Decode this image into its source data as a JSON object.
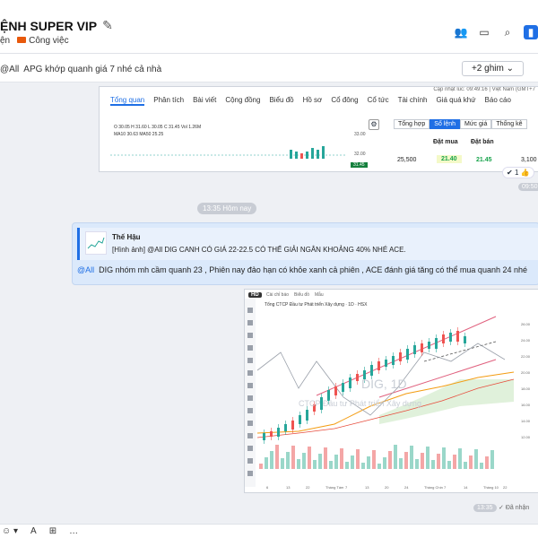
{
  "header": {
    "title": "ỆNH SUPER VIP",
    "tab_left": "ện",
    "tab_work": "Công việc"
  },
  "pinned": {
    "mention": "@All",
    "text": "APG khớp quanh giá 7 nhé cả nhà",
    "more": "+2 ghim"
  },
  "shot1": {
    "top_meta": "Cập nhật lúc: 09:49:16 | Việt Nam (GMT+7",
    "tabs": [
      "Tổng quan",
      "Phân tích",
      "Bài viết",
      "Cộng đồng",
      "Biểu đồ",
      "Hồ sơ",
      "Cổ đông",
      "Cổ tức",
      "Tài chính",
      "Giá quá khứ",
      "Báo cáo"
    ],
    "ohlc": "O 30.05  H 31.60  L 30.05  C 31.45  Vol 1.26M",
    "ma": "MA10 30.63  MA50 25.25",
    "y1": "33.00",
    "y2": "32.00",
    "badge": "31.45",
    "rtabs": [
      "Tổng hợp",
      "Sổ lệnh",
      "Mức giá",
      "Thống kê"
    ],
    "col_bid": "Đặt mua",
    "col_ask": "Đặt bán",
    "row_vol_left": "25,500",
    "row_bid": "21.40",
    "row_ask": "21.45",
    "row_vol_right": "3,100"
  },
  "reaction1": "1",
  "time1": "09:50",
  "separator": "13:35 Hôm nay",
  "reply": {
    "author": "Thế Hậu",
    "quoted": "[Hình ảnh] @All DIG CANH CÓ GIÁ 22-22.5 CÓ THỂ GIẢI NGÂN KHOẢNG 40% NHÉ ACE.",
    "mention": "@All",
    "text": "DIG nhóm mh cầm quanh 23 , Phiên nay đảo hạn có khỏe xanh cả phiên , ACE đánh giá tăng có thể mua quanh 24 nhé"
  },
  "chart2": {
    "hd": "HD",
    "toolbar": [
      "Cài chỉ báo",
      "Biểu đồ",
      "Mẫu"
    ],
    "ttl": "Tổng CTCP Đầu tư Phát triển Xây dựng · 1D · HSX",
    "watermark": "DIG, 1D",
    "watermark2": "CTCP Đầu tư Phát triển Xây dựng",
    "xlabels": [
      "6",
      "13",
      "22",
      "Tháng Tám",
      "7",
      "13",
      "20",
      "24",
      "Tháng Chín",
      "7",
      "14",
      "Tháng 10",
      "22"
    ],
    "ylabels": [
      "26.00",
      "24.00",
      "22.00",
      "20.00",
      "18.00",
      "16.00",
      "14.00",
      "12.00"
    ]
  },
  "time2": "13:35",
  "received": "Đã nhận",
  "composer_icons": [
    "sticker-icon",
    "format-text-icon",
    "attach-icon",
    "more-icon"
  ],
  "colors": {
    "accent": "#1f6fe5",
    "up": "#26a69a",
    "down": "#ef5350",
    "bubble": "#dbe9fb"
  }
}
